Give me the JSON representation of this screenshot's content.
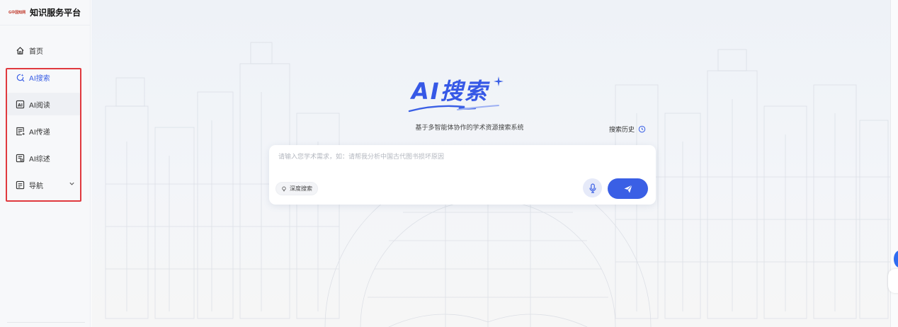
{
  "brand": {
    "logo_text": "G中国知网",
    "title": "知识服务平台"
  },
  "sidebar": {
    "items": [
      {
        "label": "首页",
        "icon": "home-icon"
      },
      {
        "label": "AI搜索",
        "icon": "ai-search-icon",
        "active": true
      },
      {
        "label": "AI阅读",
        "icon": "ai-read-icon"
      },
      {
        "label": "AI传递",
        "icon": "ai-deliver-icon"
      },
      {
        "label": "AI综述",
        "icon": "ai-review-icon"
      },
      {
        "label": "导航",
        "icon": "nav-icon",
        "expandable": true
      }
    ]
  },
  "hero": {
    "title": "AI搜索",
    "subtitle": "基于多智能体协作的学术资源搜索系统",
    "history_label": "搜索历史"
  },
  "search": {
    "placeholder": "请输入您学术需求，如：请帮我分析中国古代图书损坏原因",
    "value": "",
    "deep_search_label": "深度搜索"
  },
  "colors": {
    "accent": "#3a5fe5",
    "highlight_border": "#e0393e",
    "sidebar_bg": "#f7f8fa"
  }
}
